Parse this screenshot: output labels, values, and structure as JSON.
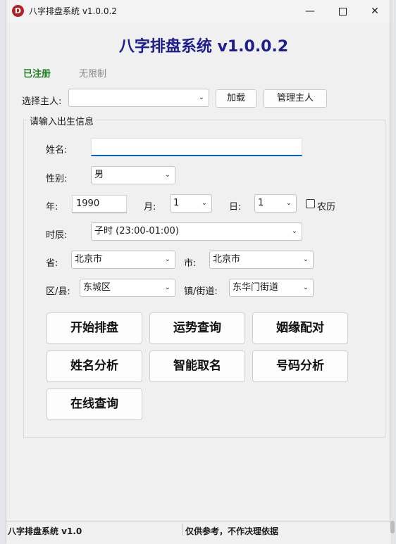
{
  "window": {
    "title": "八字排盘系统 v1.0.0.2",
    "icon_letter": "D"
  },
  "header": {
    "title": "八字排盘系统 v1.0.0.2",
    "reg_status": "已注册",
    "limit_status": "无限制"
  },
  "owner": {
    "label": "选择主人:",
    "value": "",
    "load_button": "加载",
    "manage_button": "管理主人"
  },
  "birth": {
    "group_title": "请输入出生信息",
    "name_label": "姓名:",
    "name_value": "",
    "gender_label": "性别:",
    "gender_value": "男",
    "year_label": "年:",
    "year_value": "1990",
    "month_label": "月:",
    "month_value": "1",
    "day_label": "日:",
    "day_value": "1",
    "lunar_label": "农历",
    "lunar_checked": false,
    "hour_label": "时辰:",
    "hour_value": "子时 (23:00-01:00)",
    "province_label": "省:",
    "province_value": "北京市",
    "city_label": "市:",
    "city_value": "北京市",
    "district_label": "区/县:",
    "district_value": "东城区",
    "street_label": "镇/街道:",
    "street_value": "东华门街道"
  },
  "actions": {
    "start_chart": "开始排盘",
    "fortune": "运势查询",
    "marriage": "姻缘配对",
    "name_analysis": "姓名分析",
    "smart_naming": "智能取名",
    "number_analysis": "号码分析",
    "online_query": "在线查询"
  },
  "status": {
    "left": "八字排盘系统 v1.0",
    "right": "仅供参考，不作决理依据"
  },
  "colors": {
    "title": "#1d1d8f",
    "registered": "#208220",
    "input_focus": "#0066c0",
    "app_icon": "#b21f24"
  }
}
